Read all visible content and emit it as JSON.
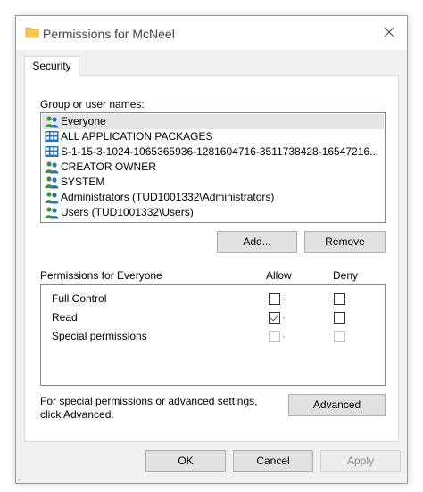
{
  "window": {
    "title": "Permissions for McNeel",
    "close_symbol": "✕"
  },
  "tabs": [
    {
      "label": "Security",
      "active": true
    }
  ],
  "group_label": "Group or user names:",
  "users": [
    {
      "name": "Everyone",
      "icon": "users-icon",
      "selected": true
    },
    {
      "name": "ALL APPLICATION PACKAGES",
      "icon": "app-package-icon",
      "selected": false
    },
    {
      "name": "S-1-15-3-1024-1065365936-1281604716-3511738428-16547216...",
      "icon": "app-package-icon",
      "selected": false
    },
    {
      "name": "CREATOR OWNER",
      "icon": "users-icon",
      "selected": false
    },
    {
      "name": "SYSTEM",
      "icon": "users-icon",
      "selected": false
    },
    {
      "name": "Administrators (TUD1001332\\Administrators)",
      "icon": "users-icon",
      "selected": false
    },
    {
      "name": "Users (TUD1001332\\Users)",
      "icon": "users-icon",
      "selected": false
    }
  ],
  "buttons": {
    "add": "Add...",
    "remove": "Remove",
    "advanced": "Advanced",
    "ok": "OK",
    "cancel": "Cancel",
    "apply": "Apply"
  },
  "permissions": {
    "header": "Permissions for Everyone",
    "allow_label": "Allow",
    "deny_label": "Deny",
    "rows": [
      {
        "name": "Full Control",
        "allow": false,
        "deny": false,
        "enabled": true
      },
      {
        "name": "Read",
        "allow": true,
        "deny": false,
        "enabled": true
      },
      {
        "name": "Special permissions",
        "allow": false,
        "deny": false,
        "enabled": false
      }
    ]
  },
  "advanced_text": {
    "line1": "For special permissions or advanced settings,",
    "line2": "click Advanced."
  },
  "colors": {
    "folder": "#f2c94c",
    "selection": "#e5e5e5",
    "user_green": "#3f8f3f",
    "user_blue": "#2b6fb5"
  }
}
